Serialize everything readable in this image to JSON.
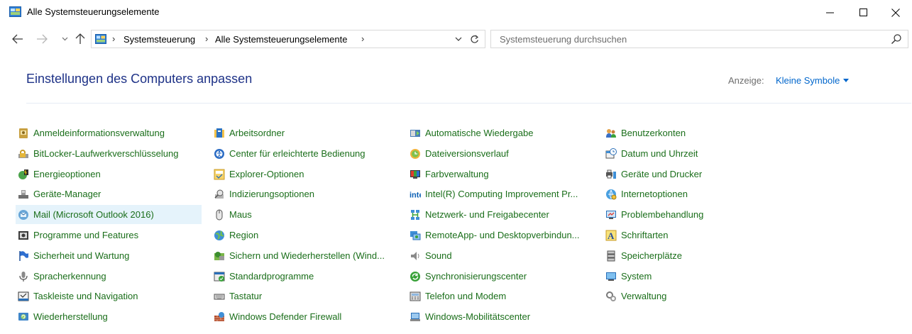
{
  "window": {
    "title": "Alle Systemsteuerungselemente"
  },
  "address": {
    "crumbs": [
      "Systemsteuerung",
      "Alle Systemsteuerungselemente"
    ]
  },
  "search": {
    "placeholder": "Systemsteuerung durchsuchen"
  },
  "header": {
    "title": "Einstellungen des Computers anpassen",
    "view_label": "Anzeige:",
    "view_value": "Kleine Symbole"
  },
  "columns": [
    [
      {
        "label": "Anmeldeinformationsverwaltung",
        "icon": "credential-manager-icon"
      },
      {
        "label": "BitLocker-Laufwerkverschlüsselung",
        "icon": "bitlocker-icon"
      },
      {
        "label": "Energieoptionen",
        "icon": "power-options-icon"
      },
      {
        "label": "Geräte-Manager",
        "icon": "device-manager-icon"
      },
      {
        "label": "Mail (Microsoft Outlook 2016)",
        "icon": "mail-icon",
        "selected": true
      },
      {
        "label": "Programme und Features",
        "icon": "programs-features-icon"
      },
      {
        "label": "Sicherheit und Wartung",
        "icon": "security-flag-icon"
      },
      {
        "label": "Spracherkennung",
        "icon": "microphone-icon"
      },
      {
        "label": "Taskleiste und Navigation",
        "icon": "taskbar-icon"
      },
      {
        "label": "Wiederherstellung",
        "icon": "recovery-icon"
      }
    ],
    [
      {
        "label": "Arbeitsordner",
        "icon": "work-folders-icon"
      },
      {
        "label": "Center für erleichterte Bedienung",
        "icon": "ease-of-access-icon"
      },
      {
        "label": "Explorer-Optionen",
        "icon": "explorer-options-icon"
      },
      {
        "label": "Indizierungsoptionen",
        "icon": "indexing-options-icon"
      },
      {
        "label": "Maus",
        "icon": "mouse-icon"
      },
      {
        "label": "Region",
        "icon": "region-globe-icon"
      },
      {
        "label": "Sichern und Wiederherstellen (Wind...",
        "icon": "backup-restore-icon"
      },
      {
        "label": "Standardprogramme",
        "icon": "default-programs-icon"
      },
      {
        "label": "Tastatur",
        "icon": "keyboard-icon"
      },
      {
        "label": "Windows Defender Firewall",
        "icon": "firewall-icon"
      }
    ],
    [
      {
        "label": "Automatische Wiedergabe",
        "icon": "autoplay-icon"
      },
      {
        "label": "Dateiversionsverlauf",
        "icon": "file-history-icon"
      },
      {
        "label": "Farbverwaltung",
        "icon": "color-management-icon"
      },
      {
        "label": "Intel(R) Computing Improvement Pr...",
        "icon": "intel-icon"
      },
      {
        "label": "Netzwerk- und Freigabecenter",
        "icon": "network-icon"
      },
      {
        "label": "RemoteApp- und Desktopverbindun...",
        "icon": "remoteapp-icon"
      },
      {
        "label": "Sound",
        "icon": "speaker-icon"
      },
      {
        "label": "Synchronisierungscenter",
        "icon": "sync-center-icon"
      },
      {
        "label": "Telefon und Modem",
        "icon": "phone-modem-icon"
      },
      {
        "label": "Windows-Mobilitätscenter",
        "icon": "mobility-center-icon"
      }
    ],
    [
      {
        "label": "Benutzerkonten",
        "icon": "user-accounts-icon"
      },
      {
        "label": "Datum und Uhrzeit",
        "icon": "date-time-icon"
      },
      {
        "label": "Geräte und Drucker",
        "icon": "devices-printers-icon"
      },
      {
        "label": "Internetoptionen",
        "icon": "internet-options-icon"
      },
      {
        "label": "Problembehandlung",
        "icon": "troubleshooting-icon"
      },
      {
        "label": "Schriftarten",
        "icon": "fonts-icon"
      },
      {
        "label": "Speicherplätze",
        "icon": "storage-spaces-icon"
      },
      {
        "label": "System",
        "icon": "system-icon"
      },
      {
        "label": "Verwaltung",
        "icon": "administrative-tools-icon"
      }
    ]
  ],
  "colors": {
    "item_text": "#1a6e1a",
    "title_blue": "#1e3287",
    "link_blue": "#0066cc",
    "selected_bg": "#e5f3fb"
  }
}
